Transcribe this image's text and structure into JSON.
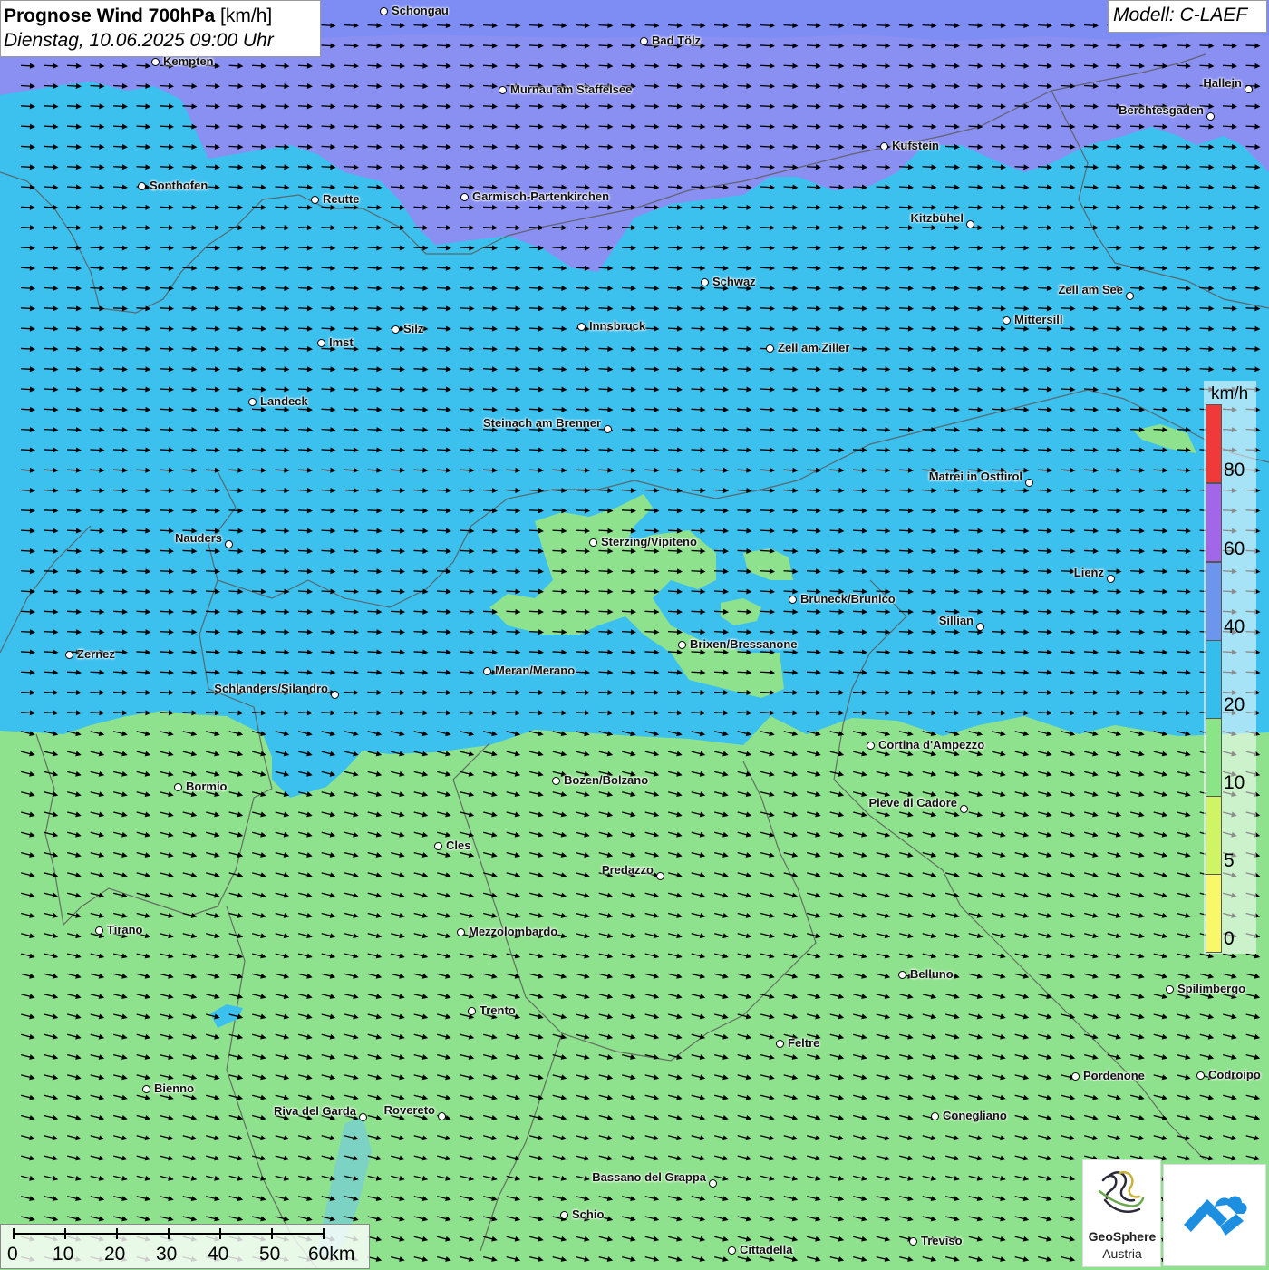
{
  "header": {
    "title": "Prognose Wind 700hPa",
    "unit": "[km/h]",
    "datetime": "Dienstag, 10.06.2025 09:00 Uhr",
    "model": "Modell: C-LAEF"
  },
  "legend": {
    "unit": "km/h",
    "labels": [
      "80",
      "60",
      "40",
      "20",
      "10",
      "5",
      "0"
    ],
    "colors": [
      "#f03a3a",
      "#a167e8",
      "#6c95ee",
      "#35bdee",
      "#89e585",
      "#cff564",
      "#f8f868"
    ]
  },
  "scale": {
    "labels": [
      "0",
      "10",
      "20",
      "30",
      "40",
      "50",
      "60km"
    ]
  },
  "map_colors": {
    "band_60_80": "#8a8ff2",
    "band_40_60": "#7d8df4",
    "band_20_40": "#3cc0ee",
    "band_10_20": "#8fe28d",
    "border": "#555555"
  },
  "cities": [
    {
      "name": "Schongau"
    },
    {
      "name": "Bad Tölz"
    },
    {
      "name": "Kempten"
    },
    {
      "name": "Murnau am Staffelsee"
    },
    {
      "name": "Hallein"
    },
    {
      "name": "Berchtesgaden"
    },
    {
      "name": "Kufstein"
    },
    {
      "name": "Sonthofen"
    },
    {
      "name": "Reutte"
    },
    {
      "name": "Garmisch-Partenkirchen"
    },
    {
      "name": "Kitzbühel"
    },
    {
      "name": "Schwaz"
    },
    {
      "name": "Zell am See"
    },
    {
      "name": "Mittersill"
    },
    {
      "name": "Silz"
    },
    {
      "name": "Innsbruck"
    },
    {
      "name": "Imst"
    },
    {
      "name": "Zell am Ziller"
    },
    {
      "name": "Landeck"
    },
    {
      "name": "Steinach am Brenner"
    },
    {
      "name": "Matrei in Osttirol"
    },
    {
      "name": "Nauders"
    },
    {
      "name": "Sterzing/Vipiteno"
    },
    {
      "name": "Lienz"
    },
    {
      "name": "Bruneck/Brunico"
    },
    {
      "name": "Sillian"
    },
    {
      "name": "Brixen/Bressanone"
    },
    {
      "name": "Zernez"
    },
    {
      "name": "Meran/Merano"
    },
    {
      "name": "Schlanders/Silandro"
    },
    {
      "name": "Cortina d'Ampezzo"
    },
    {
      "name": "Bozen/Bolzano"
    },
    {
      "name": "Bormio"
    },
    {
      "name": "Pieve di Cadore"
    },
    {
      "name": "Cles"
    },
    {
      "name": "Predazzo"
    },
    {
      "name": "Tirano"
    },
    {
      "name": "Mezzolombardo"
    },
    {
      "name": "Belluno"
    },
    {
      "name": "Spilimbergo"
    },
    {
      "name": "Trento"
    },
    {
      "name": "Feltre"
    },
    {
      "name": "Pordenone"
    },
    {
      "name": "Codroipo"
    },
    {
      "name": "Bienno"
    },
    {
      "name": "Riva del Garda"
    },
    {
      "name": "Rovereto"
    },
    {
      "name": "Conegliano"
    },
    {
      "name": "Bassano del Grappa"
    },
    {
      "name": "Schio"
    },
    {
      "name": "Treviso"
    },
    {
      "name": "Cittadella"
    }
  ],
  "logos": {
    "geosphere_line1": "GeoSphere",
    "geosphere_line2": "Austria"
  }
}
